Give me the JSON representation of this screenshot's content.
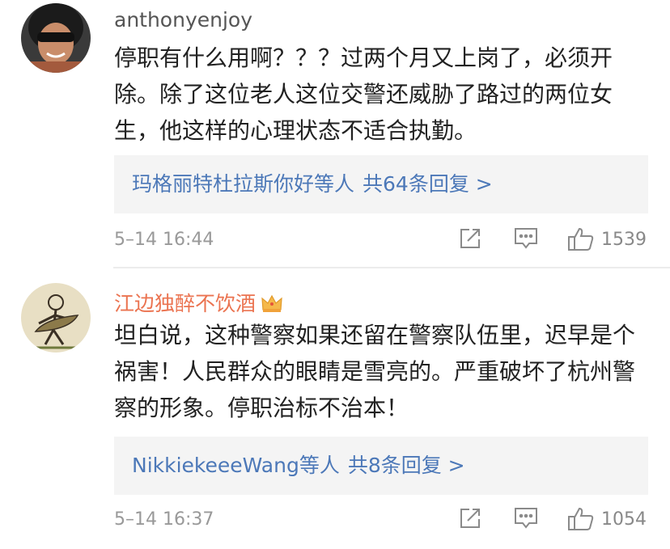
{
  "comments": [
    {
      "username": "anthonyenjoy",
      "text": "停职有什么用啊？？？过两个月又上岗了，必须开除。除了这位老人这位交警还威胁了路过的两位女生，他这样的心理状态不适合执勤。",
      "replies": {
        "names": "玛格丽特杜拉斯你好",
        "suffix": "等人",
        "total": "共64条回复 >"
      },
      "time": "5–14 16:44",
      "likes": "1539",
      "icons": [
        "share-icon",
        "comment-icon",
        "thumbs-up-icon"
      ]
    },
    {
      "username": "江边独醉不饮酒",
      "badge": "crown-icon",
      "text": "坦白说，这种警察如果还留在警察队伍里，迟早是个祸害！人民群众的眼睛是雪亮的。严重破坏了杭州警察的形象。停职治标不治本！",
      "replies": {
        "names": "NikkiekeeeWang",
        "suffix": "等人",
        "total": "共8条回复 >"
      },
      "time": "5–14 16:37",
      "likes": "1054",
      "icons": [
        "share-icon",
        "comment-icon",
        "thumbs-up-icon"
      ]
    }
  ],
  "colors": {
    "link": "#4c78b8",
    "vip_name": "#eb7350",
    "meta": "#999999",
    "reply_bg": "#f4f4f4"
  }
}
